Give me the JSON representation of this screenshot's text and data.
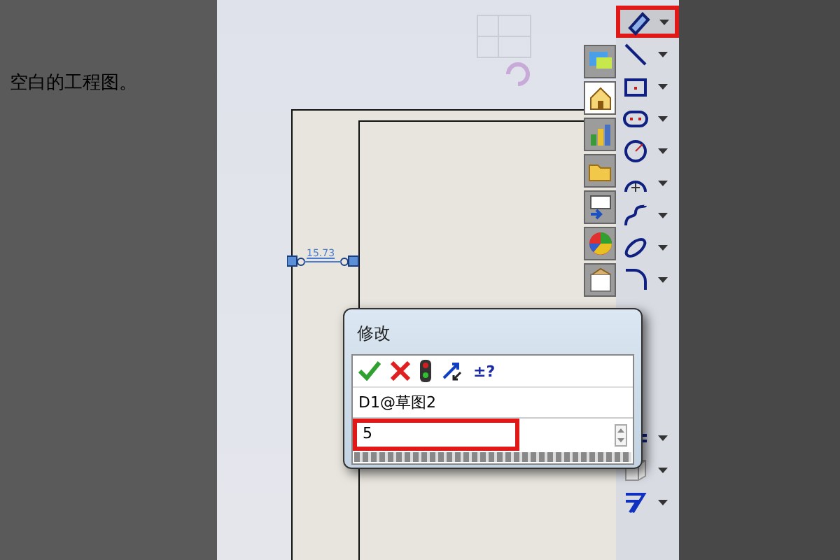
{
  "left_text": "空白的工程图。",
  "canvas": {
    "dimension_label": "15.73"
  },
  "task_tabs": [
    {
      "kind": "comment",
      "selected": false
    },
    {
      "kind": "home",
      "selected": true
    },
    {
      "kind": "chart",
      "selected": false
    },
    {
      "kind": "folder",
      "selected": false
    },
    {
      "kind": "list",
      "selected": false
    },
    {
      "kind": "appearance",
      "selected": false
    },
    {
      "kind": "clipboard",
      "selected": false
    }
  ],
  "tools": [
    {
      "kind": "dimension",
      "highlighted": true
    },
    {
      "kind": "line",
      "highlighted": false
    },
    {
      "kind": "rectangle",
      "highlighted": false
    },
    {
      "kind": "slot",
      "highlighted": false
    },
    {
      "kind": "circle",
      "highlighted": false
    },
    {
      "kind": "arc",
      "highlighted": false
    },
    {
      "kind": "spline",
      "highlighted": false
    },
    {
      "kind": "ellipse",
      "highlighted": false
    },
    {
      "kind": "fillet",
      "highlighted": false
    }
  ],
  "tools_bottom": [
    {
      "kind": "axis"
    },
    {
      "kind": "cube"
    },
    {
      "kind": "offset"
    }
  ],
  "modify_dialog": {
    "title": "修改",
    "tolerance_button": "±?",
    "dimension_name": "D1@草图2",
    "value": "5",
    "value_highlighted": true
  }
}
